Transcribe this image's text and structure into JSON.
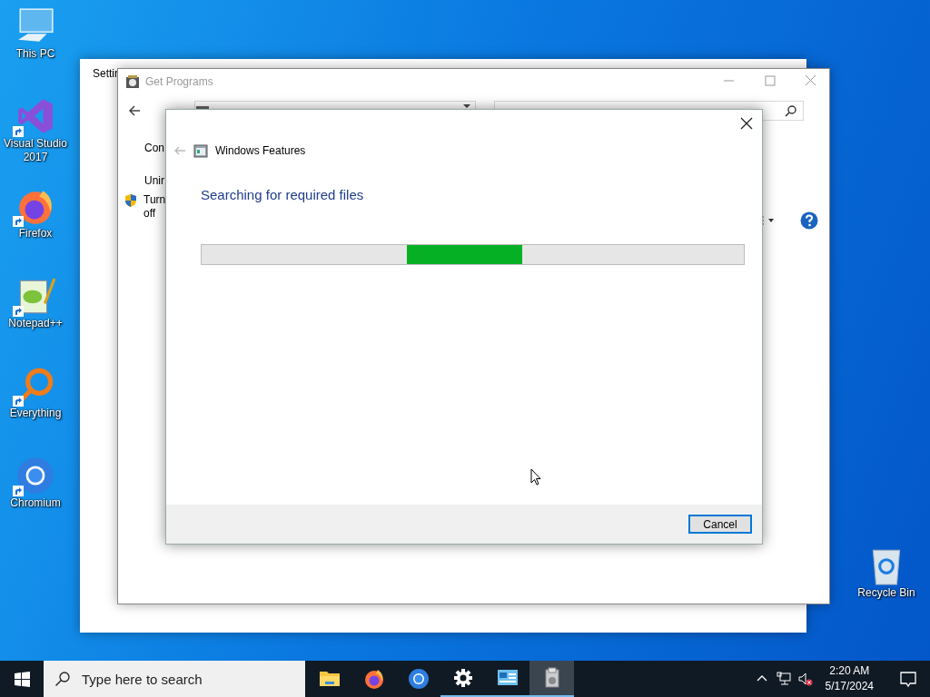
{
  "desktop_icons": [
    {
      "kind": "pc",
      "label": "This PC",
      "shortcut": false
    },
    {
      "kind": "vs",
      "label": "Visual Studio 2017",
      "shortcut": true
    },
    {
      "kind": "firefox",
      "label": "Firefox",
      "shortcut": true
    },
    {
      "kind": "notepad",
      "label": "Notepad++",
      "shortcut": true
    },
    {
      "kind": "everything",
      "label": "Everything",
      "shortcut": true
    },
    {
      "kind": "chromium",
      "label": "Chromium",
      "shortcut": true
    }
  ],
  "recycle_bin": {
    "label": "Recycle Bin"
  },
  "settings_window": {
    "title": "Settir"
  },
  "programs_window": {
    "title": "Get Programs",
    "sidebar": [
      "Con",
      "Unir"
    ],
    "shield_link": [
      "Turn",
      "off"
    ]
  },
  "dialog": {
    "title": "Windows Features",
    "heading": "Searching for required files",
    "progress": {
      "kind": "marquee"
    },
    "buttons": [
      "Cancel"
    ]
  },
  "taskbar": {
    "search_placeholder": "Type here to search",
    "apps": [
      {
        "kind": "explorer",
        "running": false,
        "selected": false
      },
      {
        "kind": "firefox",
        "running": false,
        "selected": false
      },
      {
        "kind": "chromium",
        "running": false,
        "selected": false
      },
      {
        "kind": "settings",
        "running": true,
        "selected": false
      },
      {
        "kind": "control",
        "running": true,
        "selected": false
      },
      {
        "kind": "features",
        "running": true,
        "selected": true
      }
    ],
    "time": "2:20 AM",
    "date": "5/17/2024"
  }
}
